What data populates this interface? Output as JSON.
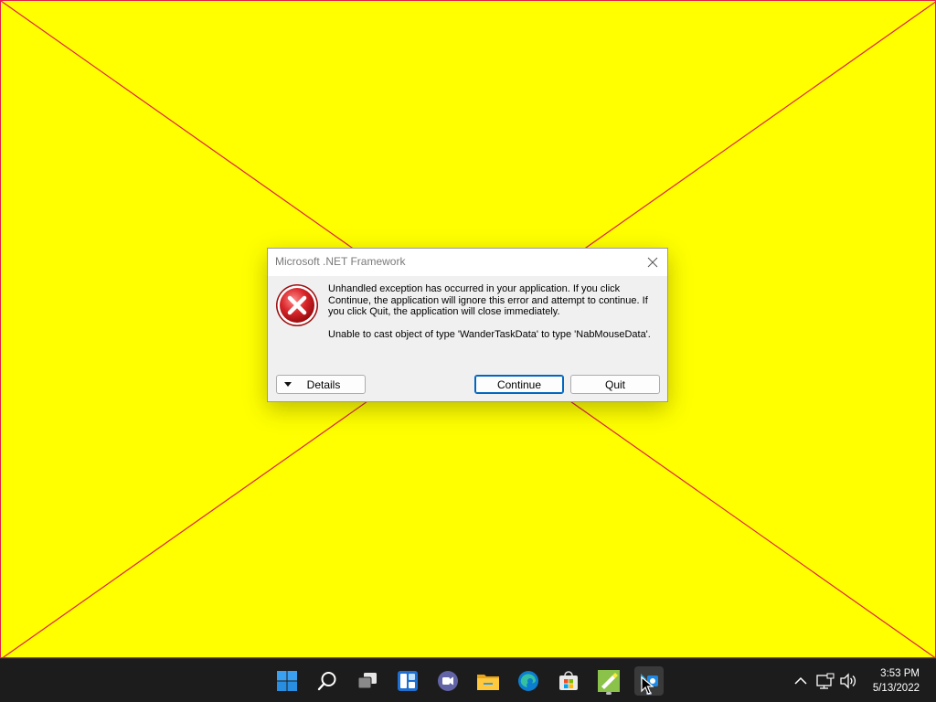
{
  "dialog": {
    "title": "Microsoft .NET Framework",
    "message_1": "Unhandled exception has occurred in your application. If you click Continue, the application will ignore this error and attempt to continue. If you click Quit, the application will close immediately.",
    "message_2": "Unable to cast object of type 'WanderTaskData' to type 'NabMouseData'.",
    "details_label": "Details",
    "continue_label": "Continue",
    "quit_label": "Quit",
    "icon": "error-icon"
  },
  "taskbar": {
    "icons": [
      "windows-start-icon",
      "search-icon",
      "task-view-icon",
      "widgets-icon",
      "teams-chat-icon",
      "file-explorer-icon",
      "edge-icon",
      "store-icon",
      "app-icon",
      "app-debug-icon"
    ],
    "time": "3:53 PM",
    "date": "5/13/2022"
  },
  "colors": {
    "desktop_background": "#ffff00",
    "cross_lines": "#e0204a",
    "taskbar": "#1c1c1c",
    "accent": "#0067c0"
  }
}
